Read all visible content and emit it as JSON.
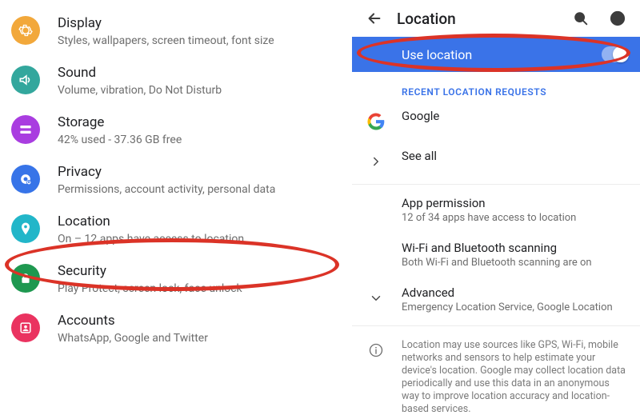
{
  "settings_items": [
    {
      "key": "display",
      "title": "Display",
      "sub": "Styles, wallpapers, screen timeout, font size"
    },
    {
      "key": "sound",
      "title": "Sound",
      "sub": "Volume, vibration, Do Not Disturb"
    },
    {
      "key": "storage",
      "title": "Storage",
      "sub": "42% used - 37.36 GB free"
    },
    {
      "key": "privacy",
      "title": "Privacy",
      "sub": "Permissions, account activity, personal data"
    },
    {
      "key": "location",
      "title": "Location",
      "sub": "On – 12 apps have access to location"
    },
    {
      "key": "security",
      "title": "Security",
      "sub": "Play Protect, screen lock, face unlock"
    },
    {
      "key": "accounts",
      "title": "Accounts",
      "sub": "WhatsApp, Google and Twitter"
    }
  ],
  "right": {
    "page_title": "Location",
    "use_location_label": "Use location",
    "use_location_on": true,
    "recent_header": "RECENT LOCATION REQUESTS",
    "recent": {
      "google": "Google",
      "see_all": "See all"
    },
    "app_permission": {
      "title": "App permission",
      "sub": "12 of 34 apps have access to location"
    },
    "scanning": {
      "title": "Wi-Fi and Bluetooth scanning",
      "sub": "Both Wi-Fi and Bluetooth scanning are on"
    },
    "advanced": {
      "title": "Advanced",
      "sub": "Emergency Location Service, Google Location"
    },
    "info": "Location may use sources like GPS, Wi-Fi, mobile networks and sensors to help estimate your device's location. Google may collect location data periodically and use this data in an anonymous way to improve location accuracy and location-based services."
  }
}
